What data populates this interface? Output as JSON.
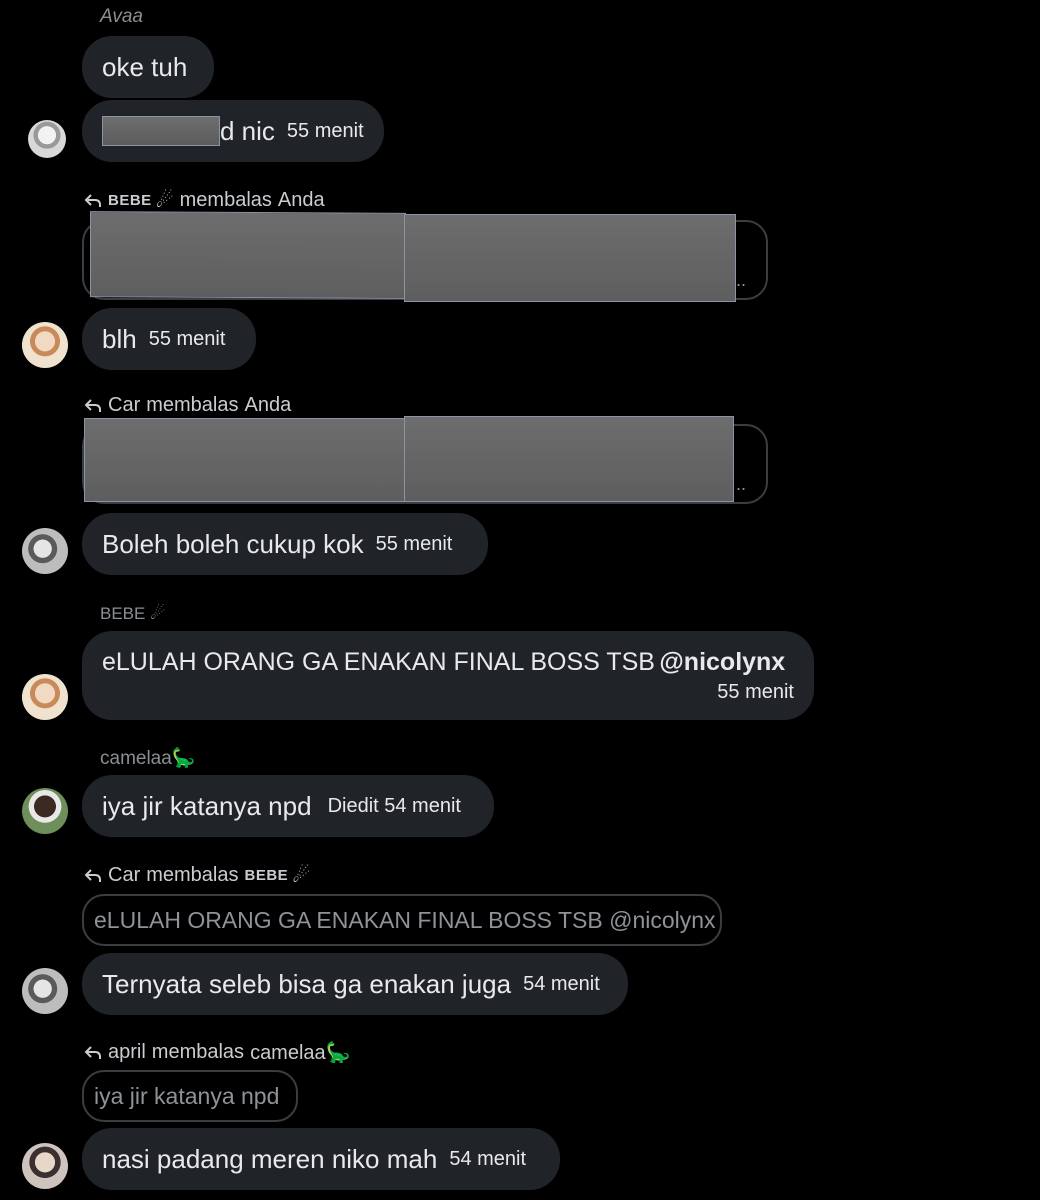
{
  "messages": [
    {
      "sender": "Avaa",
      "text": "oke tuh"
    },
    {
      "text_suffix": "d nic",
      "time": "55 menit"
    },
    {
      "reply": {
        "from": "BEBE",
        "emoji": "☄",
        "verb": "membalas",
        "to": "Anda"
      }
    },
    {
      "text": "blh",
      "time": "55 menit"
    },
    {
      "reply": {
        "from": "Car",
        "verb": "membalas",
        "to": "Anda"
      }
    },
    {
      "text": "Boleh boleh cukup kok",
      "time": "55 menit"
    },
    {
      "sender": "BEBE ☄",
      "text": "eLULAH ORANG GA ENAKAN FINAL BOSS TSB",
      "mention": "@nicolynx",
      "time": "55 menit"
    },
    {
      "sender": "camelaa🦕",
      "text": "iya jir katanya npd",
      "time": "Diedit 54 menit"
    },
    {
      "reply": {
        "from": "Car",
        "verb": "membalas",
        "to": "BEBE",
        "to_emoji": "☄"
      },
      "quote": "eLULAH ORANG GA ENAKAN FINAL BOSS TSB @nicolynx",
      "text": "Ternyata seleb bisa ga enakan juga",
      "time": "54 menit"
    },
    {
      "reply": {
        "from": "april",
        "verb": "membalas",
        "to": "camelaa🦕"
      },
      "quote": "iya jir katanya npd",
      "text": "nasi padang meren niko mah",
      "time": "54 menit"
    }
  ],
  "quote_ellipsis": "..",
  "icons": {
    "reply": "reply-arrow-icon",
    "avatar": "user-avatar-icon"
  },
  "colors": {
    "background": "#000000",
    "bubble": "#202327",
    "text": "#e7e9ea",
    "muted": "#8b8f94"
  }
}
